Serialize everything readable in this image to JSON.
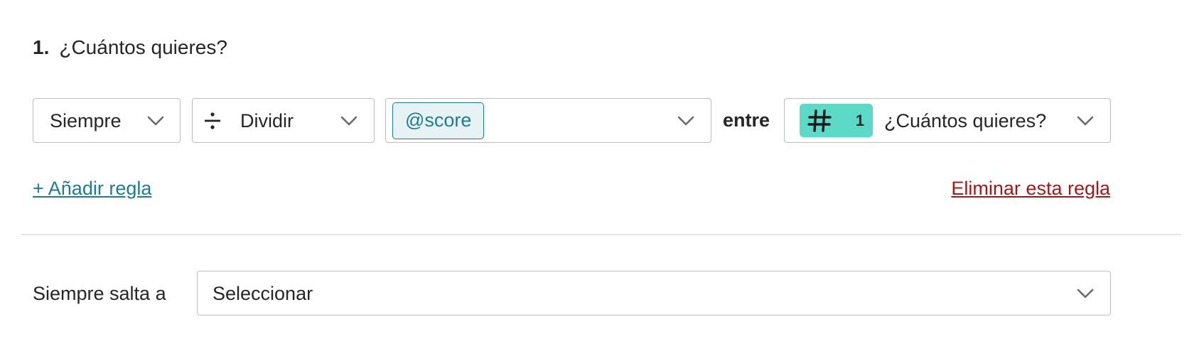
{
  "question": {
    "number": "1.",
    "title": "¿Cuántos quieres?"
  },
  "rule": {
    "condition_value": "Siempre",
    "operation_icon": "divide-icon",
    "operation_value": "Dividir",
    "variable_chip": "@score",
    "connector_text": "entre",
    "target_question_icon": "hash-icon",
    "target_question_number": "1",
    "target_question_title": "¿Cuántos quieres?"
  },
  "actions": {
    "add_rule": "+ Añadir regla",
    "delete_rule": "Eliminar esta regla"
  },
  "jump": {
    "label": "Siempre salta a",
    "select_value": "Seleccionar"
  },
  "colors": {
    "accent": "#1d7c91",
    "danger": "#a3191a",
    "number_chip": "#5dd9c8",
    "variable_chip_bg": "#e7f2f5"
  }
}
